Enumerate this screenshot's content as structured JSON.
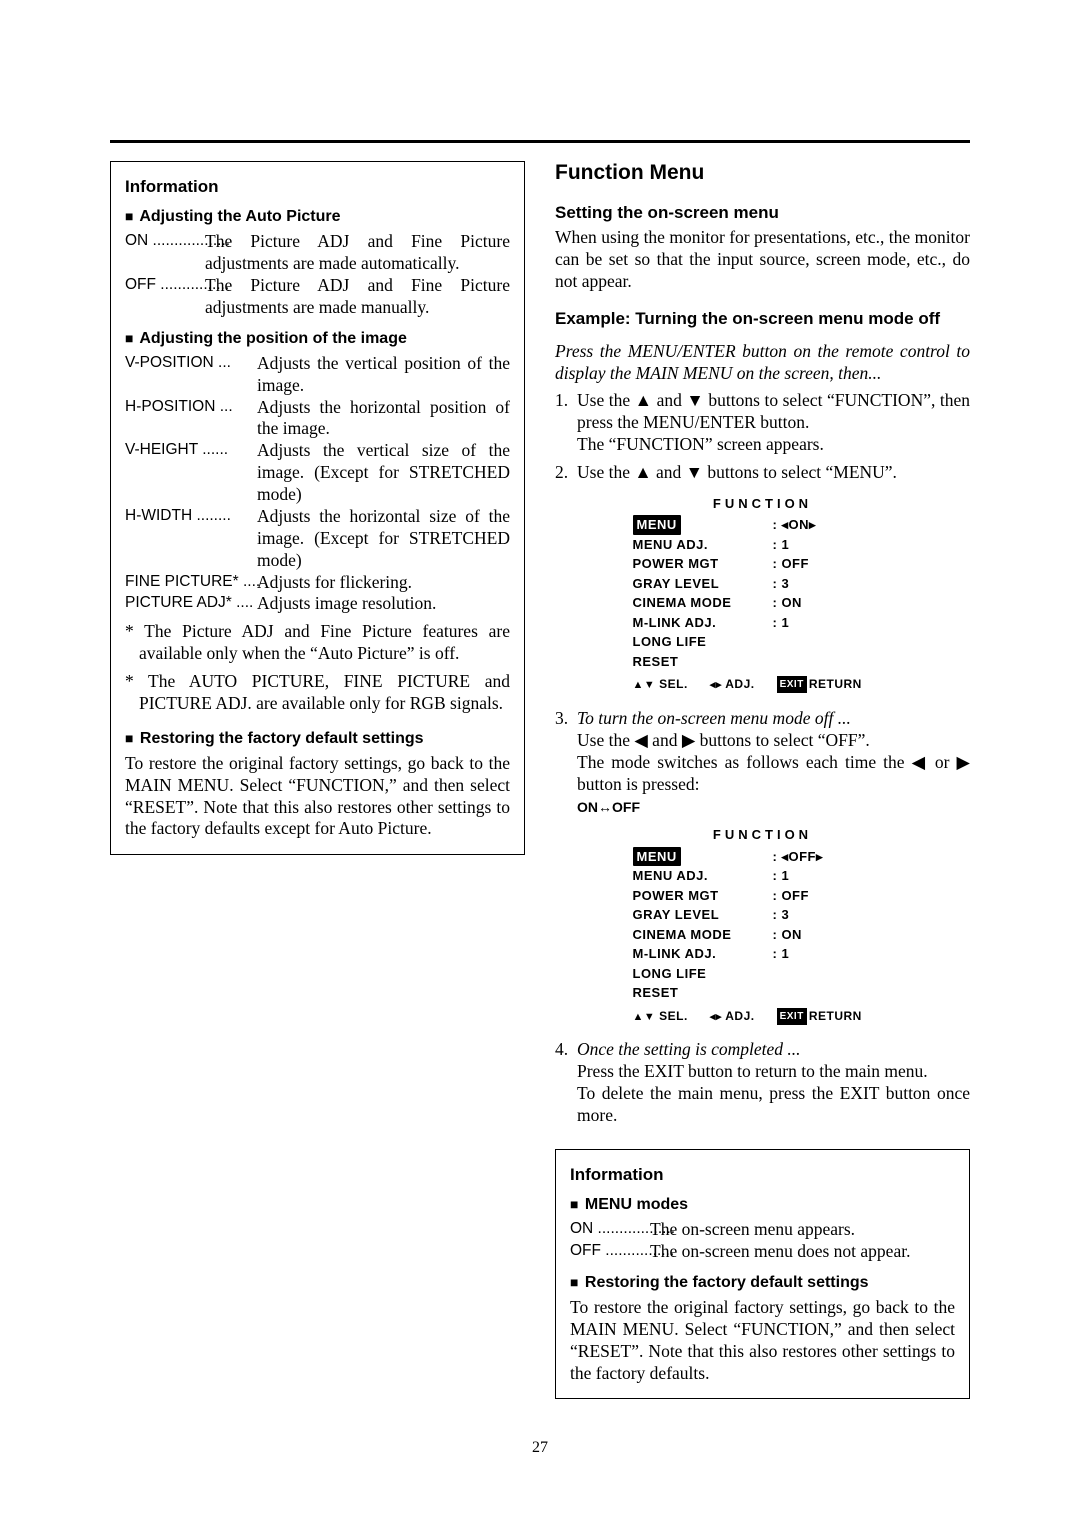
{
  "pageNumber": "27",
  "left": {
    "boxTitle": "Information",
    "sec1": {
      "title": "Adjusting the Auto Picture",
      "rows": [
        {
          "term": "ON ..................",
          "desc": "The Picture ADJ and Fine Picture adjustments are made automatically."
        },
        {
          "term": "OFF ................",
          "desc": "The Picture ADJ and Fine Picture adjustments are made manually."
        }
      ]
    },
    "sec2": {
      "title": "Adjusting the position of the image",
      "rows": [
        {
          "term": "V-POSITION ...",
          "desc": "Adjusts the vertical position of the image."
        },
        {
          "term": "H-POSITION ...",
          "desc": "Adjusts the horizontal position of the image."
        },
        {
          "term": "V-HEIGHT ......",
          "desc": "Adjusts the vertical size of the image. (Except for STRETCHED mode)"
        },
        {
          "term": "H-WIDTH ........",
          "desc": "Adjusts the horizontal size of the image. (Except for STRETCHED mode)"
        },
        {
          "term": "FINE PICTURE* ....",
          "desc": "Adjusts for flickering."
        },
        {
          "term": "PICTURE ADJ* ....",
          "desc": "Adjusts image resolution."
        }
      ],
      "note1": "* The Picture ADJ and Fine Picture features are available only when the “Auto Picture” is off.",
      "note2": "* The AUTO PICTURE, FINE PICTURE and PICTURE ADJ. are available only for RGB signals."
    },
    "sec3": {
      "title": "Restoring the factory default settings",
      "para": "To restore the original factory settings, go back to the MAIN MENU.  Select “FUNCTION,” and then select “RESET”. Note that this also restores other settings to the factory defaults except for Auto Picture."
    }
  },
  "right": {
    "heading": "Function Menu",
    "settingTitle": "Setting the on-screen menu",
    "settingPara": "When using the monitor for presentations, etc., the monitor can be set so that the input source, screen mode, etc., do not appear.",
    "exampleTitle": "Example: Turning the on-screen menu mode off",
    "pressLine": "Press the MENU/ENTER button on the remote control to display the MAIN MENU on the screen, then...",
    "step1a": "Use the ▲ and ▼ buttons to select “FUNCTION”, then press the MENU/ENTER button.",
    "step1b": "The “FUNCTION” screen appears.",
    "step2": "Use the ▲ and ▼ buttons to select “MENU”.",
    "osd1": {
      "title": "FUNCTION",
      "menuVal": ": ◂ON▸",
      "rows": [
        {
          "k": "MENU ADJ.",
          "v": ":   1"
        },
        {
          "k": "POWER MGT",
          "v": ":   OFF"
        },
        {
          "k": "GRAY LEVEL",
          "v": ":   3"
        },
        {
          "k": "CINEMA MODE",
          "v": ":   ON"
        },
        {
          "k": "M-LINK ADJ.",
          "v": ":   1"
        },
        {
          "k": "LONG LIFE",
          "v": ""
        },
        {
          "k": "RESET",
          "v": ""
        }
      ],
      "foot": {
        "sel": "SEL.",
        "adj": "ADJ.",
        "ret": "RETURN"
      }
    },
    "step3a": "To turn the on-screen menu mode off ...",
    "step3b": "Use the ◀ and ▶ buttons to select “OFF”.",
    "step3c": "The mode switches as follows each time the ◀ or ▶ button is pressed:",
    "toggle": "ON↔OFF",
    "osd2": {
      "title": "FUNCTION",
      "menuVal": ": ◂OFF▸",
      "rows": [
        {
          "k": "MENU ADJ.",
          "v": ":   1"
        },
        {
          "k": "POWER MGT",
          "v": ":   OFF"
        },
        {
          "k": "GRAY LEVEL",
          "v": ":   3"
        },
        {
          "k": "CINEMA MODE",
          "v": ":   ON"
        },
        {
          "k": "M-LINK ADJ.",
          "v": ":   1"
        },
        {
          "k": "LONG LIFE",
          "v": ""
        },
        {
          "k": "RESET",
          "v": ""
        }
      ],
      "foot": {
        "sel": "SEL.",
        "adj": "ADJ.",
        "ret": "RETURN"
      }
    },
    "step4a": "Once the setting is completed ...",
    "step4b": "Press the EXIT button to return to the main menu.",
    "step4c": "To delete the main menu, press the EXIT button once more.",
    "box": {
      "title": "Information",
      "sec1": {
        "title": "MENU modes",
        "rows": [
          {
            "term": "ON ..................",
            "desc": "The on-screen menu appears."
          },
          {
            "term": "OFF ................",
            "desc": "The on-screen menu does not appear."
          }
        ]
      },
      "sec2": {
        "title": "Restoring the factory default settings",
        "para": "To restore the original factory settings, go back to the MAIN MENU.  Select “FUNCTION,” and then select “RESET”.  Note that this also restores other settings to the factory defaults."
      }
    }
  }
}
